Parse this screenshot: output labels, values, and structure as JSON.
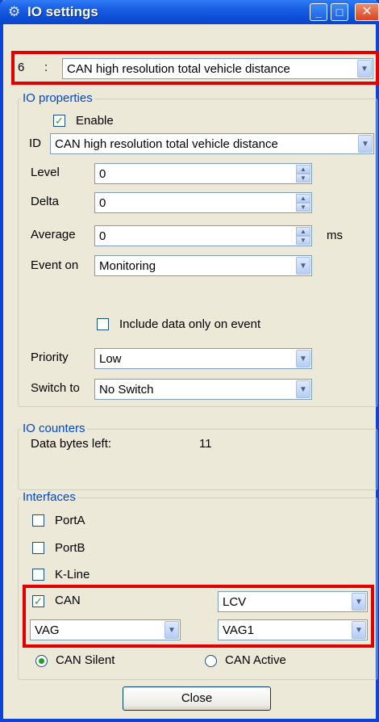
{
  "window": {
    "title": "IO settings"
  },
  "top": {
    "index": "6",
    "separator": ":",
    "selected": "CAN high resolution total vehicle distance"
  },
  "io_properties": {
    "title": "IO properties",
    "enable_label": "Enable",
    "id_label": "ID",
    "id_value": "CAN high resolution total vehicle distance",
    "level_label": "Level",
    "level_value": "0",
    "delta_label": "Delta",
    "delta_value": "0",
    "average_label": "Average",
    "average_value": "0",
    "average_unit": "ms",
    "event_on_label": "Event on",
    "event_on_value": "Monitoring",
    "include_label": "Include data only on event",
    "priority_label": "Priority",
    "priority_value": "Low",
    "switch_label": "Switch to",
    "switch_value": "No Switch"
  },
  "io_counters": {
    "title": "IO counters",
    "bytes_label": "Data bytes left:",
    "bytes_value": "11"
  },
  "interfaces": {
    "title": "Interfaces",
    "porta": "PortA",
    "portb": "PortB",
    "kline": "K-Line",
    "can": "CAN",
    "can_type": "LCV",
    "brand": "VAG",
    "model": "VAG1",
    "silent": "CAN Silent",
    "active": "CAN Active"
  },
  "close_label": "Close"
}
